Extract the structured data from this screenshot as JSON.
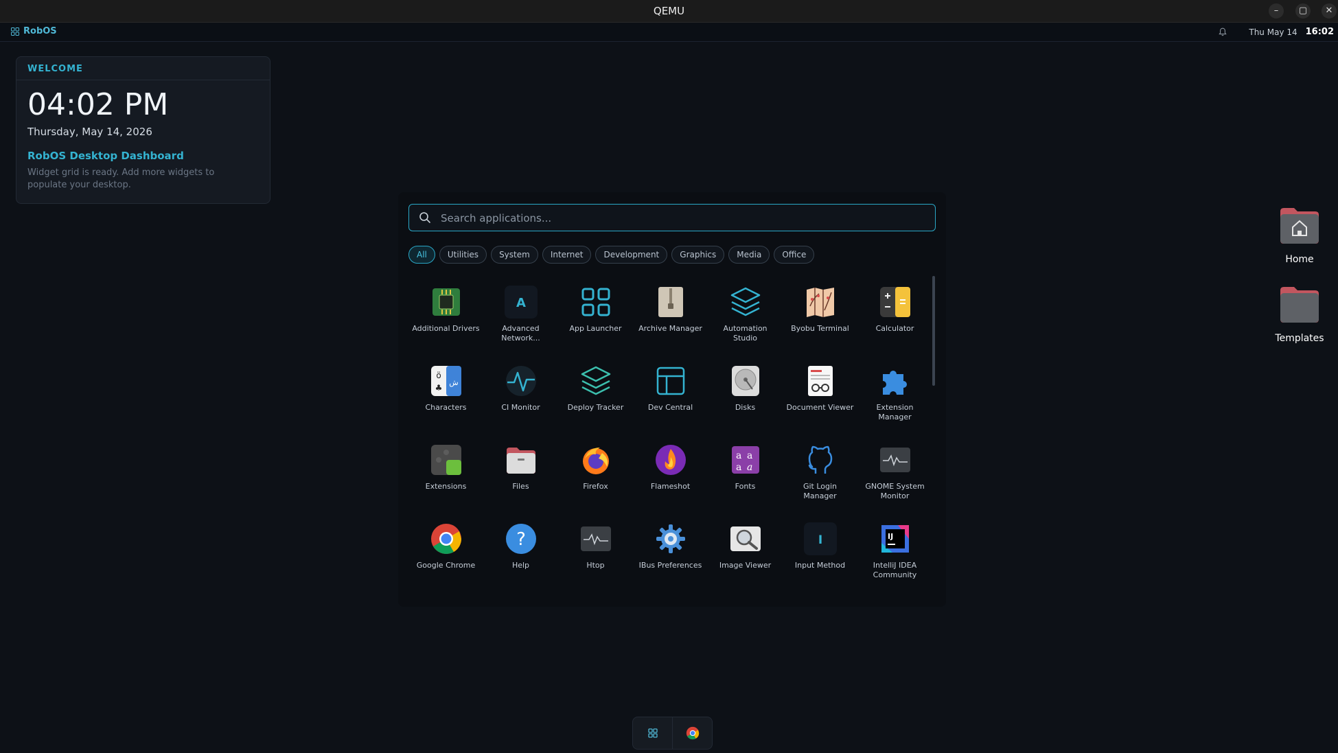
{
  "window": {
    "title": "QEMU"
  },
  "topbar": {
    "brand": "RobOS",
    "date": "Thu May 14",
    "time": "16:02"
  },
  "welcome": {
    "header": "WELCOME",
    "clock": "04:02 PM",
    "date": "Thursday, May 14, 2026",
    "dashboard_title": "RobOS Desktop Dashboard",
    "description": "Widget grid is ready. Add more widgets to populate your desktop."
  },
  "launcher": {
    "search_placeholder": "Search applications...",
    "categories": [
      "All",
      "Utilities",
      "System",
      "Internet",
      "Development",
      "Graphics",
      "Media",
      "Office"
    ],
    "active_category": "All",
    "apps": [
      {
        "label": "Additional Drivers",
        "icon": "chip-icon"
      },
      {
        "label": "Advanced Network...",
        "icon": "network-a-icon"
      },
      {
        "label": "App Launcher",
        "icon": "grid-icon"
      },
      {
        "label": "Archive Manager",
        "icon": "archive-icon"
      },
      {
        "label": "Automation Studio",
        "icon": "layers-icon"
      },
      {
        "label": "Byobu Terminal",
        "icon": "byobu-icon"
      },
      {
        "label": "Calculator",
        "icon": "calculator-icon"
      },
      {
        "label": "Characters",
        "icon": "characters-icon"
      },
      {
        "label": "CI Monitor",
        "icon": "pulse-icon"
      },
      {
        "label": "Deploy Tracker",
        "icon": "stack-icon"
      },
      {
        "label": "Dev Central",
        "icon": "layout-icon"
      },
      {
        "label": "Disks",
        "icon": "disk-icon"
      },
      {
        "label": "Document Viewer",
        "icon": "document-icon"
      },
      {
        "label": "Extension Manager",
        "icon": "puzzle-icon"
      },
      {
        "label": "Extensions",
        "icon": "puzzle-dark-icon"
      },
      {
        "label": "Files",
        "icon": "folder-icon"
      },
      {
        "label": "Firefox",
        "icon": "firefox-icon"
      },
      {
        "label": "Flameshot",
        "icon": "flameshot-icon"
      },
      {
        "label": "Fonts",
        "icon": "fonts-icon"
      },
      {
        "label": "Git Login Manager",
        "icon": "github-icon"
      },
      {
        "label": "GNOME System Monitor",
        "icon": "monitor-icon"
      },
      {
        "label": "Google Chrome",
        "icon": "chrome-icon"
      },
      {
        "label": "Help",
        "icon": "help-icon"
      },
      {
        "label": "Htop",
        "icon": "htop-icon"
      },
      {
        "label": "IBus Preferences",
        "icon": "gear-icon"
      },
      {
        "label": "Image Viewer",
        "icon": "image-viewer-icon"
      },
      {
        "label": "Input Method",
        "icon": "input-method-icon"
      },
      {
        "label": "IntelliJ IDEA Community",
        "icon": "intellij-icon"
      }
    ]
  },
  "desktop": {
    "icons": [
      {
        "label": "Home"
      },
      {
        "label": "Templates"
      }
    ]
  },
  "colors": {
    "accent": "#2aa8c7",
    "background": "#0d1117"
  }
}
